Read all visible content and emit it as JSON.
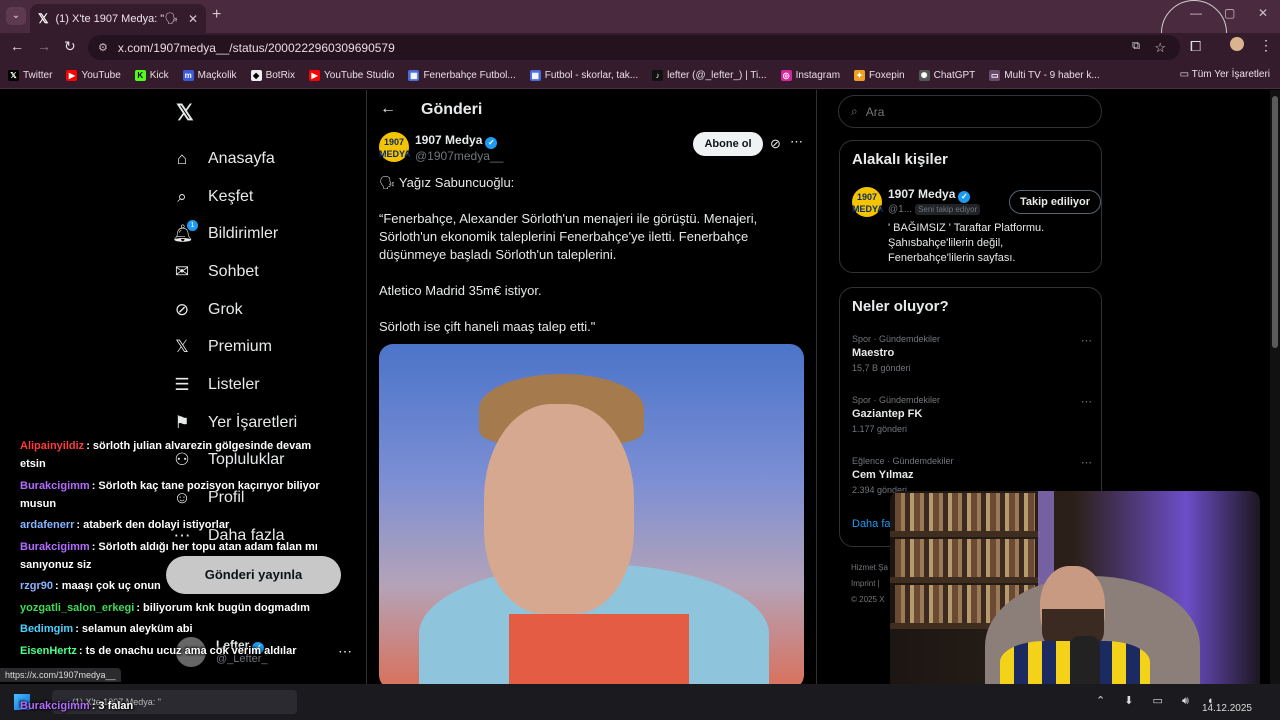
{
  "browser": {
    "tab_title": "(1) X'te 1907 Medya: \"🗣 Yağız",
    "url": "x.com/1907medya__/status/2000222960309690579",
    "bookmarks": [
      "Twitter",
      "YouTube",
      "Kick",
      "Maçkolik",
      "BotRix",
      "YouTube Studio",
      "Fenerbahçe Futbol...",
      "Futbol - skorlar, tak...",
      "lefter (@_lefter_) | Ti...",
      "Instagram",
      "Foxepin",
      "ChatGPT",
      "Multi TV - 9 haber k..."
    ],
    "bookmarks_all": "Tüm Yer İşaretleri"
  },
  "nav": {
    "items": [
      "Anasayfa",
      "Keşfet",
      "Bildirimler",
      "Sohbet",
      "Grok",
      "Premium",
      "Listeler",
      "Yer İşaretleri",
      "Topluluklar",
      "Profil",
      "Daha fazla"
    ],
    "notif_count": "1",
    "post_button": "Gönderi yayınla",
    "account_name": "Lefter",
    "account_handle": "@_Lefter_"
  },
  "main": {
    "header": "Gönderi",
    "author_name": "1907 Medya",
    "author_handle": "@1907medya__",
    "logo_text": "1907 MEDYA",
    "subscribe": "Abone ol",
    "paragraphs": [
      "🗣 Yağız Sabuncuoğlu:",
      "“Fenerbahçe, Alexander Sörloth'un menajeri ile görüştü. Menajeri, Sörloth'un ekonomik taleplerini Fenerbahçe'ye iletti. Fenerbahçe düşünmeye başladı Sörloth'un taleplerini.",
      "Atletico Madrid 35m€ istiyor.",
      "Sörloth ise çift haneli maaş talep etti.\""
    ]
  },
  "right": {
    "search_placeholder": "Ara",
    "related_title": "Alakalı kişiler",
    "related_name": "1907 Medya",
    "related_handle": "@1...",
    "related_tag": "Seni takip ediyor",
    "following_button": "Takip ediliyor",
    "related_bio": "' BAĞIMSIZ ' Taraftar Platformu. Şahısbahçe'lilerin değil, Fenerbahçe'lilerin sayfası.",
    "trends_title": "Neler oluyor?",
    "trends": [
      {
        "meta": "Spor · Gündemdekiler",
        "name": "Maestro",
        "count": "15,7 B gönderi"
      },
      {
        "meta": "Spor · Gündemdekiler",
        "name": "Gaziantep FK",
        "count": "1.177 gönderi"
      },
      {
        "meta": "Eğlence · Gündemdekiler",
        "name": "Cem Yılmaz",
        "count": "2.394 gönderi"
      }
    ],
    "show_more": "Daha fa",
    "footer": [
      "Hizmet Şa",
      "Imprint |",
      "© 2025 X"
    ]
  },
  "chat": [
    {
      "user": "Alipainyildiz",
      "color": "#ff3b3b",
      "text": ": sörloth julian alvarezin gölgesinde devam etsin"
    },
    {
      "user": "Burakcigimm",
      "color": "#b26cff",
      "text": ": Sörloth kaç tane pozisyon kaçırıyor biliyor musun"
    },
    {
      "user": "ardafenerr",
      "color": "#8ab4ff",
      "text": ": ataberk den dolayi istiyorlar"
    },
    {
      "user": "Burakcigimm",
      "color": "#b26cff",
      "text": ": Sörloth aldığı her topu atan adam falan mı sanıyonuz siz"
    },
    {
      "user": "rzgr90",
      "color": "#8ab4ff",
      "text": ": maaşı çok uç onun"
    },
    {
      "user": "yozgatli_salon_erkegi",
      "color": "#3ddc55",
      "text": ": biliyorum knk bugün dogmadım"
    },
    {
      "user": "Bedimgim",
      "color": "#4ad0ff",
      "text": ": selamun aleyküm abi"
    },
    {
      "user": "EisenHertz",
      "color": "#4cff88",
      "text": ": ts de onachu ucuz ama cok verim aldılar"
    },
    {
      "user": "Burakcigimm",
      "color": "#b26cff",
      "text": ": 3 falan"
    }
  ],
  "taskbar": {
    "status_url": "https://x.com/1907medya__",
    "task_label": "(1) X'te 1907 Medya: \"",
    "date": "14.12.2025"
  }
}
